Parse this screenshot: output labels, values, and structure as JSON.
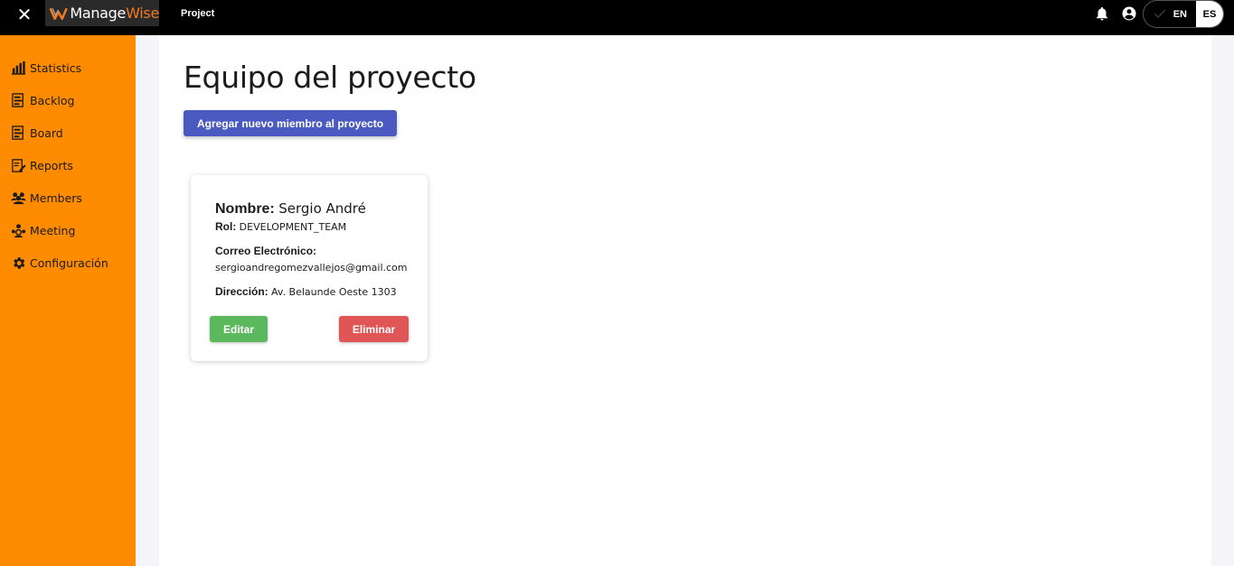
{
  "topbar": {
    "close_icon": "close-icon",
    "logo": {
      "part1": "Manage",
      "part2": "Wise"
    },
    "project_label": "Project",
    "language": {
      "en_label": "EN",
      "es_label": "ES",
      "selected": "ES"
    }
  },
  "sidebar": {
    "items": [
      {
        "label": "Statistics",
        "icon": "bar-chart-icon"
      },
      {
        "label": "Backlog",
        "icon": "backlog-icon"
      },
      {
        "label": "Board",
        "icon": "board-icon"
      },
      {
        "label": "Reports",
        "icon": "report-edit-icon"
      },
      {
        "label": "Members",
        "icon": "members-icon"
      },
      {
        "label": "Meeting",
        "icon": "meeting-icon"
      },
      {
        "label": "Configuración",
        "icon": "gear-icon"
      }
    ]
  },
  "main": {
    "title": "Equipo del proyecto",
    "add_member_label": "Agregar nuevo miembro al proyecto",
    "members": [
      {
        "name_key": "Nombre:",
        "name": "Sergio André",
        "role_key": "Rol:",
        "role": "DEVELOPMENT_TEAM",
        "email_key": "Correo Electrónico:",
        "email": "sergioandregomezvallejos@gmail.com",
        "address_key": "Dirección:",
        "address": "Av. Belaunde Oeste 1303",
        "edit_label": "Editar",
        "delete_label": "Eliminar"
      }
    ]
  },
  "colors": {
    "sidebar": "#ff8c00",
    "topbar": "#000000",
    "primary_button": "#4a5ac0",
    "edit_button": "#5cb85c",
    "delete_button": "#e05656",
    "logo_accent": "#f47a20"
  }
}
